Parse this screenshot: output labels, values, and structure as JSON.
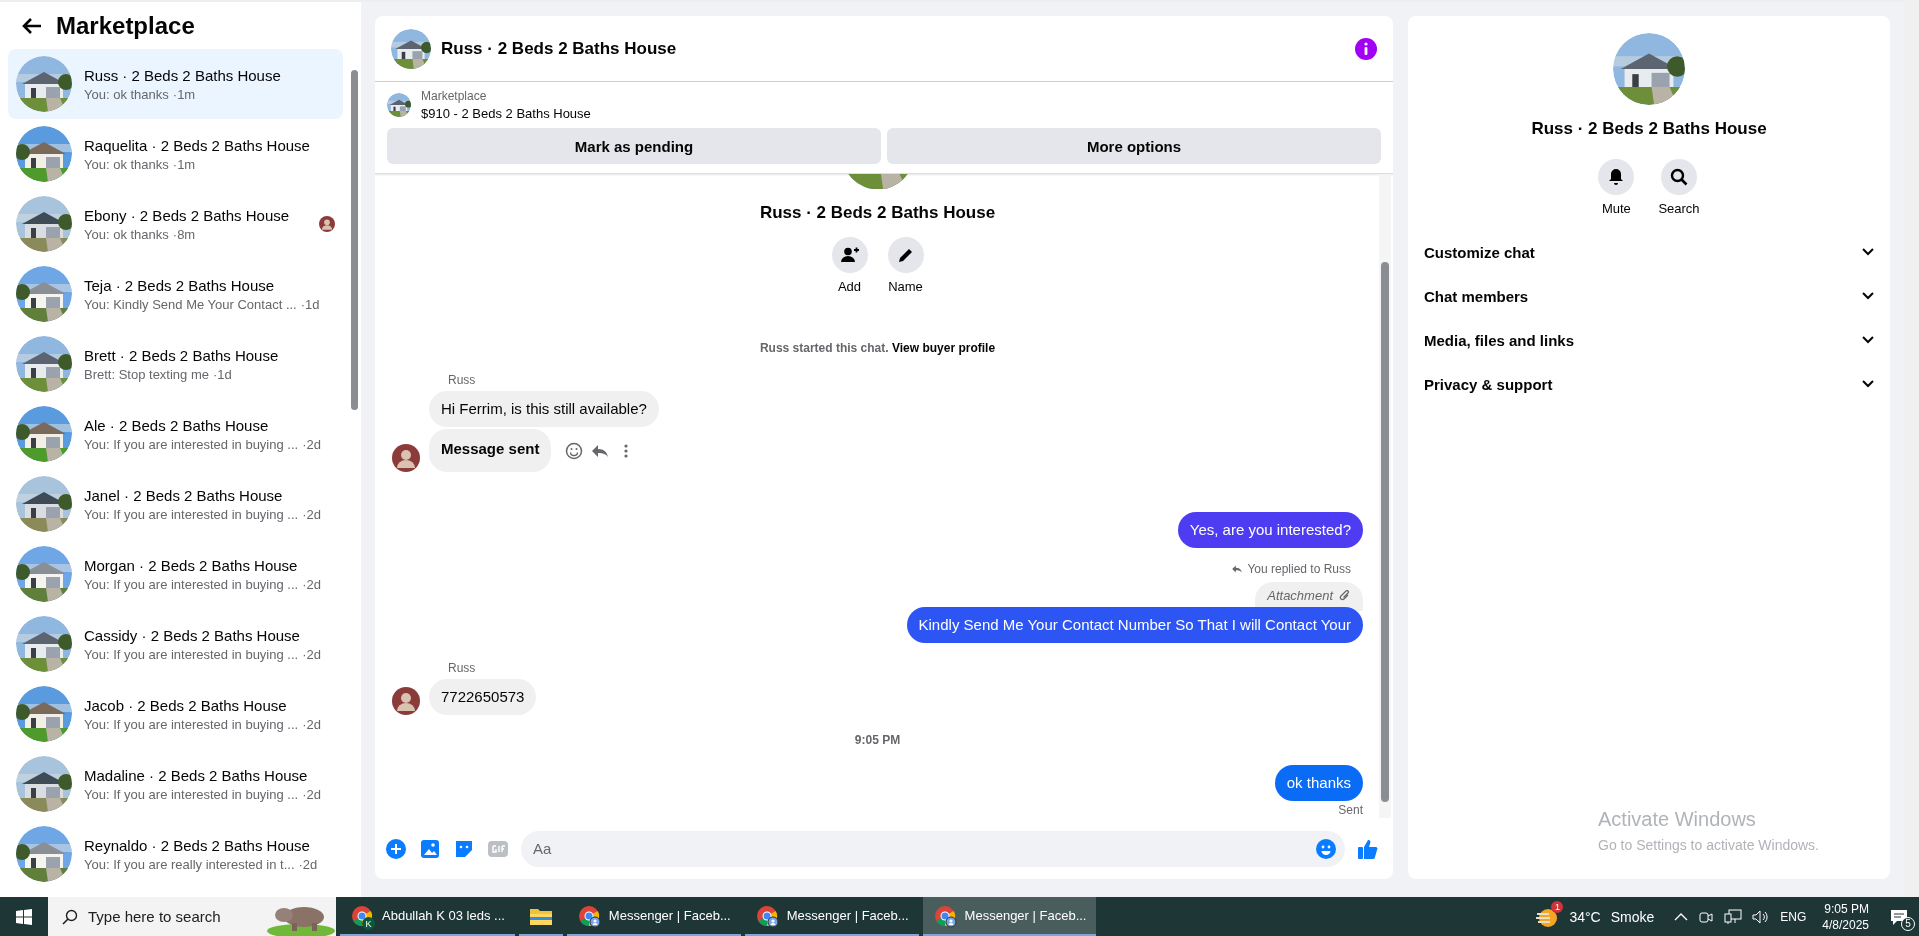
{
  "sidebar": {
    "title": "Marketplace",
    "conversations": [
      {
        "name": "Russ · 2 Beds 2 Baths House",
        "preview": "You: ok thanks",
        "time": "·1m",
        "selected": true,
        "seen": false
      },
      {
        "name": "Raquelita · 2 Beds 2 Baths House",
        "preview": "You: ok thanks",
        "time": "·1m",
        "selected": false,
        "seen": false
      },
      {
        "name": "Ebony · 2 Beds 2 Baths House",
        "preview": "You: ok thanks",
        "time": "·8m",
        "selected": false,
        "seen": true
      },
      {
        "name": "Teja · 2 Beds 2 Baths House",
        "preview": "You: Kindly Send Me Your Contact ...",
        "time": "·1d",
        "selected": false,
        "seen": false
      },
      {
        "name": "Brett · 2 Beds 2 Baths House",
        "preview": "Brett: Stop texting me",
        "time": "·1d",
        "selected": false,
        "seen": false
      },
      {
        "name": "Ale · 2 Beds 2 Baths House",
        "preview": "You: If you are interested in buying ...",
        "time": "·2d",
        "selected": false,
        "seen": false
      },
      {
        "name": "Janel · 2 Beds 2 Baths House",
        "preview": "You: If you are interested in buying ...",
        "time": "·2d",
        "selected": false,
        "seen": false
      },
      {
        "name": "Morgan · 2 Beds 2 Baths House",
        "preview": "You: If you are interested in buying ...",
        "time": "·2d",
        "selected": false,
        "seen": false
      },
      {
        "name": "Cassidy · 2 Beds 2 Baths House",
        "preview": "You: If you are interested in buying ...",
        "time": "·2d",
        "selected": false,
        "seen": false
      },
      {
        "name": "Jacob · 2 Beds 2 Baths House",
        "preview": "You: If you are interested in buying ...",
        "time": "·2d",
        "selected": false,
        "seen": false
      },
      {
        "name": "Madaline · 2 Beds 2 Baths House",
        "preview": "You: If you are interested in buying ...",
        "time": "·2d",
        "selected": false,
        "seen": false
      },
      {
        "name": "Reynaldo · 2 Beds 2 Baths House",
        "preview": "You: If you are really interested in t...",
        "time": "·2d",
        "selected": false,
        "seen": false
      }
    ]
  },
  "chat": {
    "title": "Russ · 2 Beds 2 Baths House",
    "listing": {
      "label": "Marketplace",
      "title": "$910 - 2 Beds 2 Baths House"
    },
    "buttons": [
      "Mark as pending",
      "More options"
    ],
    "profile_name": "Russ · 2 Beds 2 Baths House",
    "profile_actions": [
      {
        "label": "Add",
        "kind": "add-person"
      },
      {
        "label": "Name",
        "kind": "edit"
      }
    ],
    "note": {
      "text": "Russ started this chat.",
      "link": "View buyer profile"
    },
    "messages": [
      {
        "kind": "sender",
        "text": "Russ"
      },
      {
        "kind": "incoming",
        "text": "Hi Ferrim, is this still available?",
        "avatar": false,
        "bold": false,
        "hover_actions": false
      },
      {
        "kind": "incoming",
        "text": "Message sent",
        "avatar": true,
        "bold": true,
        "hover_actions": true
      },
      {
        "kind": "outgoing",
        "text": "Yes, are you interested?",
        "color": "#4e3cf2"
      },
      {
        "kind": "reply_note",
        "text": "You replied to Russ"
      },
      {
        "kind": "attachment",
        "text": "Attachment"
      },
      {
        "kind": "outgoing",
        "text": "Kindly Send Me Your Contact Number So That I will Contact Your",
        "color": "#2d55f4"
      },
      {
        "kind": "sender",
        "text": "Russ"
      },
      {
        "kind": "incoming",
        "text": "7722650573",
        "avatar": true,
        "bold": false,
        "hover_actions": false
      },
      {
        "kind": "time",
        "text": "9:05 PM"
      },
      {
        "kind": "outgoing",
        "text": "ok thanks",
        "color": "#0a6cf5"
      },
      {
        "kind": "status",
        "text": "Sent"
      }
    ],
    "composer": {
      "placeholder": "Aa"
    }
  },
  "details": {
    "name": "Russ · 2 Beds 2 Baths House",
    "actions": [
      {
        "label": "Mute",
        "kind": "bell"
      },
      {
        "label": "Search",
        "kind": "search"
      }
    ],
    "sections": [
      {
        "label": "Customize chat",
        "expanded": false
      },
      {
        "label": "Chat members",
        "expanded": false
      },
      {
        "label": "Media, files and links",
        "expanded": false
      },
      {
        "label": "Privacy & support",
        "expanded": false
      }
    ]
  },
  "watermark": {
    "title": "Activate Windows",
    "subtitle": "Go to Settings to activate Windows."
  },
  "taskbar": {
    "search_placeholder": "Type here to search",
    "apps": [
      {
        "kind": "browser",
        "label": "Abdullah K 03 leds ...",
        "badge": "K",
        "active": false
      },
      {
        "kind": "folder",
        "active": false
      },
      {
        "kind": "browser",
        "label": "Messenger | Faceb...",
        "active": false
      },
      {
        "kind": "browser",
        "label": "Messenger | Faceb...",
        "active": false
      },
      {
        "kind": "browser",
        "label": "Messenger | Faceb...",
        "active": true
      }
    ],
    "weather": {
      "badge": "1",
      "temperature": "34°C",
      "condition": "Smoke"
    },
    "language": "ENG",
    "time": "9:05 PM",
    "date": "4/8/2025",
    "notifications": "5"
  }
}
